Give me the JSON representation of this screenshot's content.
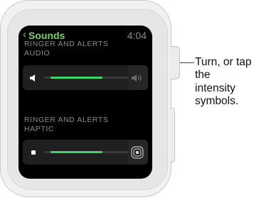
{
  "status": {
    "back_label": "Sounds",
    "back_chevron": "‹",
    "time": "4:04"
  },
  "audio": {
    "title_line1": "RINGER AND ALERTS",
    "title_line2": "AUDIO",
    "level": 0.62,
    "decrease_icon": "speaker-low-icon",
    "increase_icon": "speaker-high-icon"
  },
  "haptic": {
    "title_line1": "RINGER AND ALERTS",
    "title_line2": "HAPTIC",
    "level": 0.62,
    "decrease_icon": "haptic-low-icon",
    "increase_icon": "haptic-high-icon"
  },
  "callout": {
    "text": "Turn, or tap the intensity symbols."
  },
  "colors": {
    "accent": "#3fd467",
    "back": "#7cd26a",
    "screen": "#000000"
  }
}
